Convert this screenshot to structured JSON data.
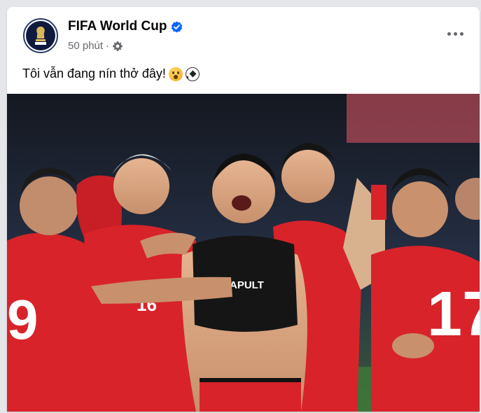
{
  "post": {
    "page_name": "FIFA World Cup",
    "verified_icon": "verified-badge-icon",
    "timestamp": "50 phút",
    "separator": "·",
    "audience_icon": "gear-icon",
    "text": "Tôi vẫn đang nín thở đây!",
    "emojis": [
      "astonished-face-emoji",
      "soccer-ball-emoji"
    ],
    "menu_icon": "more-options-icon"
  },
  "photo": {
    "description_icon": "players-celebration-photo",
    "jersey_numbers": [
      "9",
      "16",
      "17"
    ],
    "sponsor_text": "APULT"
  },
  "colors": {
    "verified": "#0866ff",
    "jersey_red": "#d8232a",
    "secondary_text": "#65676b"
  }
}
